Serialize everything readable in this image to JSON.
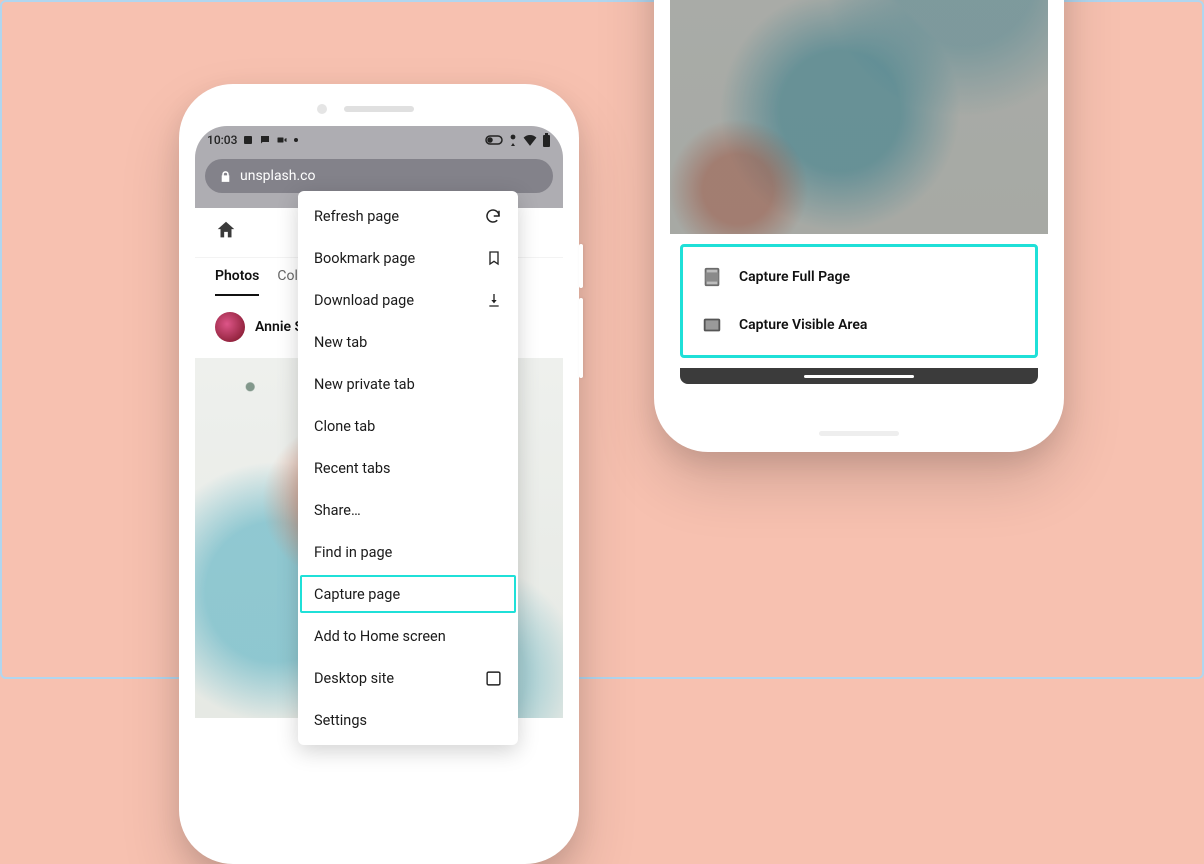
{
  "status": {
    "time": "10:03"
  },
  "urlbar": {
    "url_truncated": "unsplash.co"
  },
  "site": {
    "tabs": {
      "photos": "Photos",
      "collections": "Collect"
    },
    "author": "Annie Sprat"
  },
  "menu": {
    "refresh": "Refresh page",
    "bookmark": "Bookmark page",
    "download": "Download page",
    "newtab": "New tab",
    "newprivate": "New private tab",
    "clone": "Clone tab",
    "recent": "Recent tabs",
    "share": "Share…",
    "find": "Find in page",
    "capture": "Capture page",
    "addhome": "Add to Home screen",
    "desktop": "Desktop site",
    "settings": "Settings"
  },
  "capture_sheet": {
    "full": "Capture Full Page",
    "visible": "Capture Visible Area"
  }
}
